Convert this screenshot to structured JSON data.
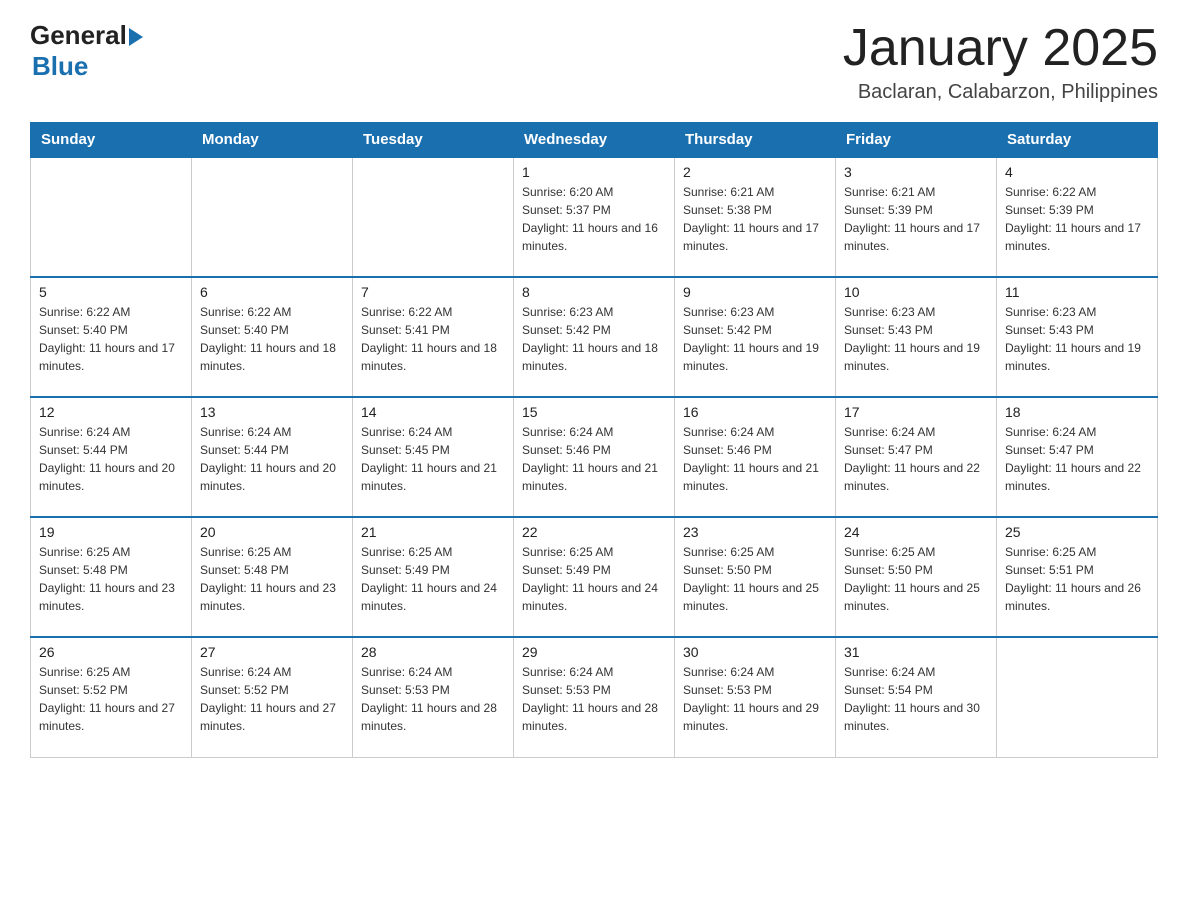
{
  "header": {
    "logo": {
      "general": "General",
      "blue": "Blue"
    },
    "title": "January 2025",
    "subtitle": "Baclaran, Calabarzon, Philippines"
  },
  "calendar": {
    "days_of_week": [
      "Sunday",
      "Monday",
      "Tuesday",
      "Wednesday",
      "Thursday",
      "Friday",
      "Saturday"
    ],
    "weeks": [
      [
        {
          "day": "",
          "info": ""
        },
        {
          "day": "",
          "info": ""
        },
        {
          "day": "",
          "info": ""
        },
        {
          "day": "1",
          "info": "Sunrise: 6:20 AM\nSunset: 5:37 PM\nDaylight: 11 hours and 16 minutes."
        },
        {
          "day": "2",
          "info": "Sunrise: 6:21 AM\nSunset: 5:38 PM\nDaylight: 11 hours and 17 minutes."
        },
        {
          "day": "3",
          "info": "Sunrise: 6:21 AM\nSunset: 5:39 PM\nDaylight: 11 hours and 17 minutes."
        },
        {
          "day": "4",
          "info": "Sunrise: 6:22 AM\nSunset: 5:39 PM\nDaylight: 11 hours and 17 minutes."
        }
      ],
      [
        {
          "day": "5",
          "info": "Sunrise: 6:22 AM\nSunset: 5:40 PM\nDaylight: 11 hours and 17 minutes."
        },
        {
          "day": "6",
          "info": "Sunrise: 6:22 AM\nSunset: 5:40 PM\nDaylight: 11 hours and 18 minutes."
        },
        {
          "day": "7",
          "info": "Sunrise: 6:22 AM\nSunset: 5:41 PM\nDaylight: 11 hours and 18 minutes."
        },
        {
          "day": "8",
          "info": "Sunrise: 6:23 AM\nSunset: 5:42 PM\nDaylight: 11 hours and 18 minutes."
        },
        {
          "day": "9",
          "info": "Sunrise: 6:23 AM\nSunset: 5:42 PM\nDaylight: 11 hours and 19 minutes."
        },
        {
          "day": "10",
          "info": "Sunrise: 6:23 AM\nSunset: 5:43 PM\nDaylight: 11 hours and 19 minutes."
        },
        {
          "day": "11",
          "info": "Sunrise: 6:23 AM\nSunset: 5:43 PM\nDaylight: 11 hours and 19 minutes."
        }
      ],
      [
        {
          "day": "12",
          "info": "Sunrise: 6:24 AM\nSunset: 5:44 PM\nDaylight: 11 hours and 20 minutes."
        },
        {
          "day": "13",
          "info": "Sunrise: 6:24 AM\nSunset: 5:44 PM\nDaylight: 11 hours and 20 minutes."
        },
        {
          "day": "14",
          "info": "Sunrise: 6:24 AM\nSunset: 5:45 PM\nDaylight: 11 hours and 21 minutes."
        },
        {
          "day": "15",
          "info": "Sunrise: 6:24 AM\nSunset: 5:46 PM\nDaylight: 11 hours and 21 minutes."
        },
        {
          "day": "16",
          "info": "Sunrise: 6:24 AM\nSunset: 5:46 PM\nDaylight: 11 hours and 21 minutes."
        },
        {
          "day": "17",
          "info": "Sunrise: 6:24 AM\nSunset: 5:47 PM\nDaylight: 11 hours and 22 minutes."
        },
        {
          "day": "18",
          "info": "Sunrise: 6:24 AM\nSunset: 5:47 PM\nDaylight: 11 hours and 22 minutes."
        }
      ],
      [
        {
          "day": "19",
          "info": "Sunrise: 6:25 AM\nSunset: 5:48 PM\nDaylight: 11 hours and 23 minutes."
        },
        {
          "day": "20",
          "info": "Sunrise: 6:25 AM\nSunset: 5:48 PM\nDaylight: 11 hours and 23 minutes."
        },
        {
          "day": "21",
          "info": "Sunrise: 6:25 AM\nSunset: 5:49 PM\nDaylight: 11 hours and 24 minutes."
        },
        {
          "day": "22",
          "info": "Sunrise: 6:25 AM\nSunset: 5:49 PM\nDaylight: 11 hours and 24 minutes."
        },
        {
          "day": "23",
          "info": "Sunrise: 6:25 AM\nSunset: 5:50 PM\nDaylight: 11 hours and 25 minutes."
        },
        {
          "day": "24",
          "info": "Sunrise: 6:25 AM\nSunset: 5:50 PM\nDaylight: 11 hours and 25 minutes."
        },
        {
          "day": "25",
          "info": "Sunrise: 6:25 AM\nSunset: 5:51 PM\nDaylight: 11 hours and 26 minutes."
        }
      ],
      [
        {
          "day": "26",
          "info": "Sunrise: 6:25 AM\nSunset: 5:52 PM\nDaylight: 11 hours and 27 minutes."
        },
        {
          "day": "27",
          "info": "Sunrise: 6:24 AM\nSunset: 5:52 PM\nDaylight: 11 hours and 27 minutes."
        },
        {
          "day": "28",
          "info": "Sunrise: 6:24 AM\nSunset: 5:53 PM\nDaylight: 11 hours and 28 minutes."
        },
        {
          "day": "29",
          "info": "Sunrise: 6:24 AM\nSunset: 5:53 PM\nDaylight: 11 hours and 28 minutes."
        },
        {
          "day": "30",
          "info": "Sunrise: 6:24 AM\nSunset: 5:53 PM\nDaylight: 11 hours and 29 minutes."
        },
        {
          "day": "31",
          "info": "Sunrise: 6:24 AM\nSunset: 5:54 PM\nDaylight: 11 hours and 30 minutes."
        },
        {
          "day": "",
          "info": ""
        }
      ]
    ]
  }
}
